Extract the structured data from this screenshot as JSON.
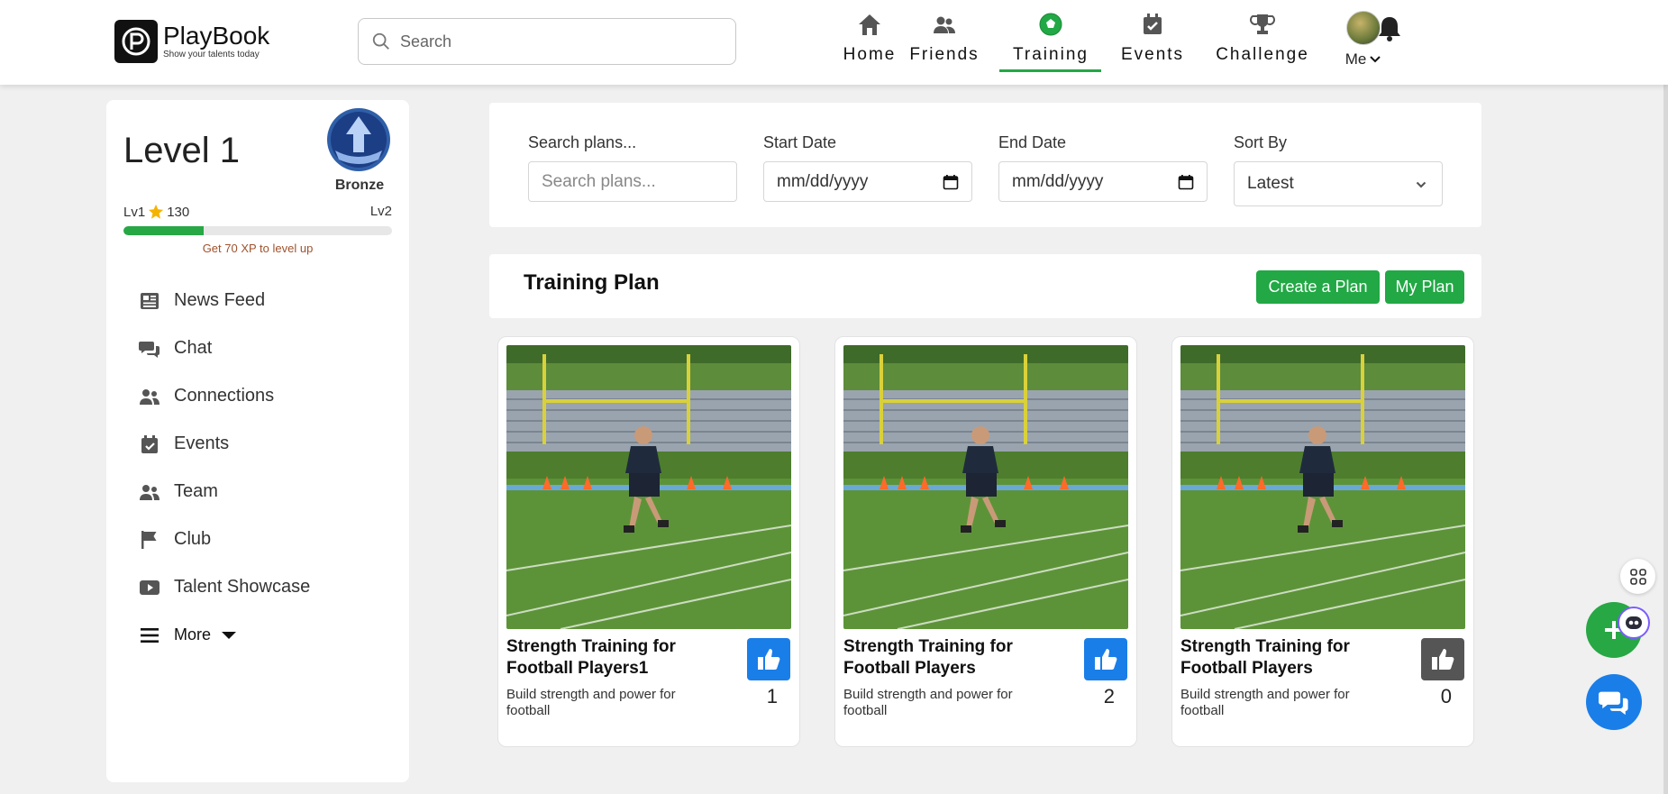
{
  "header": {
    "logo_title": "PlayBook",
    "logo_tagline": "Show your talents today",
    "search_placeholder": "Search",
    "nav": [
      {
        "label": "Home",
        "icon": "home-icon"
      },
      {
        "label": "Friends",
        "icon": "friends-icon"
      },
      {
        "label": "Training",
        "icon": "soccer-ball-icon",
        "active": true
      },
      {
        "label": "Events",
        "icon": "calendar-icon"
      },
      {
        "label": "Challenge",
        "icon": "trophy-icon"
      }
    ],
    "me_label": "Me",
    "accent": "#22a845"
  },
  "sidebar": {
    "level_title": "Level 1",
    "badge_label": "Bronze",
    "lv_left": "Lv1",
    "xp_value": "130",
    "lv_right": "Lv2",
    "xp_progress": 0.3,
    "xp_note": "Get 70 XP to level up",
    "items": [
      {
        "label": "News Feed",
        "icon": "newspaper-icon"
      },
      {
        "label": "Chat",
        "icon": "chat-icon"
      },
      {
        "label": "Connections",
        "icon": "users-icon"
      },
      {
        "label": "Events",
        "icon": "calendar-check-icon"
      },
      {
        "label": "Team",
        "icon": "team-icon"
      },
      {
        "label": "Club",
        "icon": "flag-icon"
      },
      {
        "label": "Talent Showcase",
        "icon": "youtube-icon"
      }
    ],
    "more_label": "More"
  },
  "filters": {
    "search_label": "Search plans...",
    "search_placeholder": "Search plans...",
    "start_label": "Start Date",
    "start_placeholder": "mm/dd/yyyy",
    "end_label": "End Date",
    "end_placeholder": "mm/dd/yyyy",
    "sort_label": "Sort By",
    "sort_value": "Latest"
  },
  "plan": {
    "title": "Training Plan",
    "create_label": "Create a Plan",
    "my_plan_label": "My Plan"
  },
  "cards": [
    {
      "title": "Strength Training for Football Players1",
      "desc": "Build strength and power for football",
      "likes": "1",
      "liked": true
    },
    {
      "title": "Strength Training for Football Players",
      "desc": "Build strength and power for football",
      "likes": "2",
      "liked": true
    },
    {
      "title": "Strength Training for Football Players",
      "desc": "Build strength and power for football",
      "likes": "0",
      "liked": false
    }
  ],
  "colors": {
    "like_active": "#1a7ee8",
    "like_inactive": "#555555",
    "green": "#22a845"
  }
}
